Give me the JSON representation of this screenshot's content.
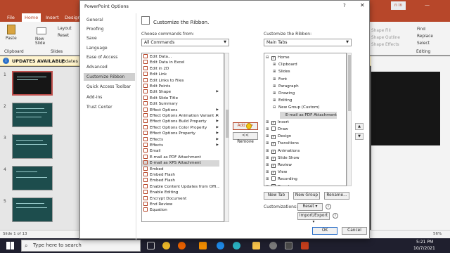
{
  "powerpoint": {
    "tabs": [
      "File",
      "Home",
      "Insert",
      "Design"
    ],
    "ribbon": {
      "paste": "Paste",
      "layout": "Layout",
      "reset": "Reset",
      "new_slide": "New Slide",
      "clipboard_group": "Clipboard",
      "slides_group": "Slides",
      "find": "Find",
      "replace": "Replace",
      "select": "Select",
      "editing_group": "Editing",
      "shape_fill": "Shape Fill",
      "shape_outline": "Shape Outline",
      "shape_effects": "Shape Effects",
      "sign_in": "n in"
    },
    "update_bar": {
      "title": "UPDATES AVAILABLE",
      "text": "Updates fo"
    },
    "slide_numbers": [
      "1",
      "2",
      "3",
      "4",
      "5"
    ],
    "status": {
      "slide_info": "Slide 1 of 13",
      "zoom": "56%"
    }
  },
  "dialog": {
    "title": "PowerPoint Options",
    "help": "?",
    "close": "✕",
    "nav": [
      "General",
      "Proofing",
      "Save",
      "Language",
      "Ease of Access",
      "Advanced",
      "Customize Ribbon",
      "Quick Access Toolbar",
      "Add-ins",
      "Trust Center"
    ],
    "selected_nav": "Customize Ribbon",
    "heading": "Customize the Ribbon.",
    "choose_label": "Choose commands from:",
    "choose_value": "All Commands",
    "customize_label": "Customize the Ribbon:",
    "customize_value": "Main Tabs",
    "commands": [
      "Edit Data...",
      "Edit Data in Excel",
      "Edit in 2D",
      "Edit Link",
      "Edit Links to Files",
      "Edit Points",
      "Edit Shape",
      "Edit Slide Title",
      "Edit Summary",
      "Effect Options",
      "Effect Options Animation Variant ...",
      "Effect Options Build Property",
      "Effect Options Color Property",
      "Effect Options Property",
      "Effects",
      "Effects",
      "Email",
      "E-mail as PDF Attachment",
      "E-mail as XPS Attachment",
      "Embed",
      "Embed Flash",
      "Embed Flash",
      "Enable Content Updates from Offi...",
      "Enable Editing",
      "Encrypt Document",
      "End Review",
      "Equation"
    ],
    "selected_command": "E-mail as XPS Attachment",
    "tabs_tree": [
      {
        "label": "Home",
        "checked": true,
        "expanded": true,
        "level": 0
      },
      {
        "label": "Clipboard",
        "level": 1
      },
      {
        "label": "Slides",
        "level": 1
      },
      {
        "label": "Font",
        "level": 1
      },
      {
        "label": "Paragraph",
        "level": 1
      },
      {
        "label": "Drawing",
        "level": 1
      },
      {
        "label": "Editing",
        "level": 1
      },
      {
        "label": "New Group (Custom)",
        "level": 1,
        "expanded": true
      },
      {
        "label": "E-mail as PDF Attachment",
        "level": 2,
        "selected": true
      },
      {
        "label": "Insert",
        "checked": true,
        "level": 0
      },
      {
        "label": "Draw",
        "checked": false,
        "level": 0
      },
      {
        "label": "Design",
        "checked": true,
        "level": 0
      },
      {
        "label": "Transitions",
        "checked": true,
        "level": 0
      },
      {
        "label": "Animations",
        "checked": true,
        "level": 0
      },
      {
        "label": "Slide Show",
        "checked": true,
        "level": 0
      },
      {
        "label": "Review",
        "checked": true,
        "level": 0
      },
      {
        "label": "View",
        "checked": true,
        "level": 0
      },
      {
        "label": "Recording",
        "checked": false,
        "level": 0
      },
      {
        "label": "Developer",
        "checked": false,
        "level": 0
      }
    ],
    "add_button": "Add >>",
    "remove_button": "<< Remove",
    "new_tab": "New Tab",
    "new_group": "New Group",
    "rename": "Rename...",
    "customizations_label": "Customizations:",
    "reset": "Reset",
    "import_export": "Import/Export",
    "ok": "OK",
    "cancel": "Cancel"
  },
  "taskbar": {
    "search_placeholder": "Type here to search",
    "time": "5:21 PM",
    "date": "10/7/2021"
  },
  "colors": {
    "accent": "#b7472a",
    "taskbar": "#1f1f2e"
  }
}
